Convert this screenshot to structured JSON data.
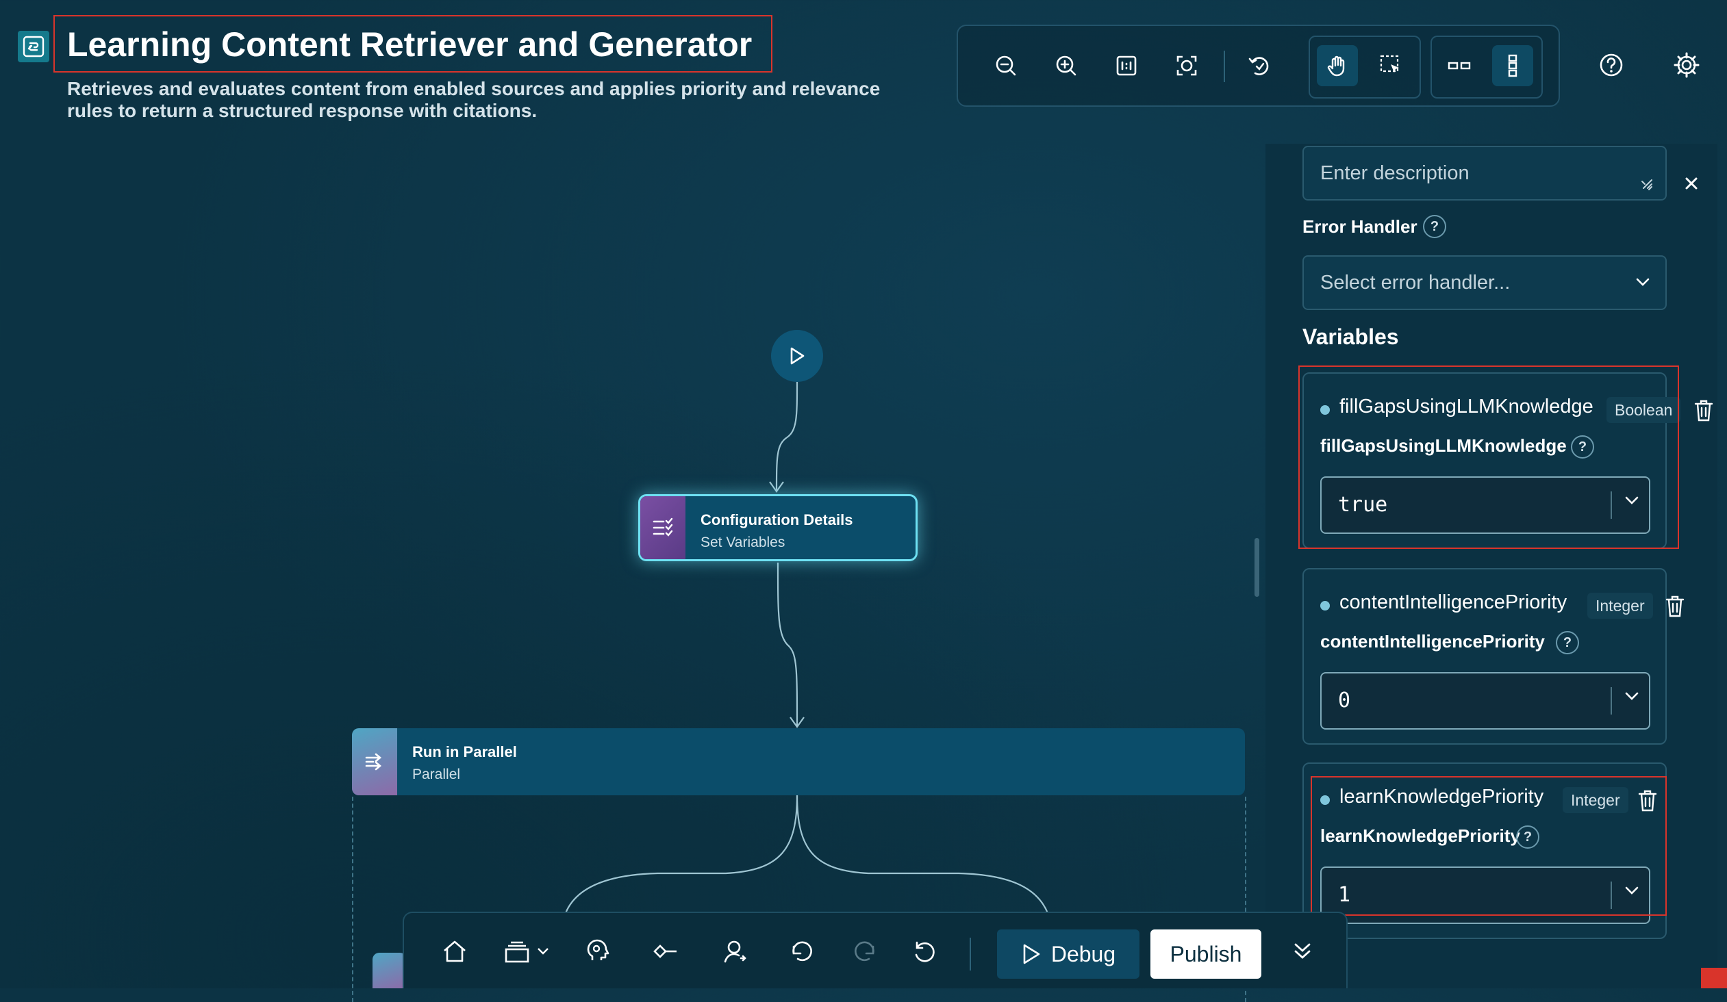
{
  "header": {
    "title": "Learning Content Retriever and Generator",
    "subtitle": "Retrieves and evaluates content from enabled sources and applies priority and relevance rules to return a structured response with citations."
  },
  "toolbar": {
    "icons": [
      "zoom-out-icon",
      "zoom-in-icon",
      "actual-size-icon",
      "fit-to-screen-icon",
      "reset-view-icon",
      "pan-hand-icon",
      "select-area-icon",
      "horizontal-layout-icon",
      "vertical-layout-icon"
    ],
    "help_icon": "help-icon",
    "settings_icon": "gear-icon"
  },
  "canvas": {
    "config_node": {
      "title": "Configuration Details",
      "subtitle": "Set Variables"
    },
    "parallel_node": {
      "title": "Run in Parallel",
      "subtitle": "Parallel"
    }
  },
  "panel": {
    "description_placeholder": "Enter description",
    "error_handler_label": "Error Handler",
    "error_handler_placeholder": "Select error handler...",
    "variables_title": "Variables",
    "variables": [
      {
        "name": "fillGapsUsingLLMKnowledge",
        "type": "Boolean",
        "label": "fillGapsUsingLLMKnowledge",
        "value": "true"
      },
      {
        "name": "contentIntelligencePriority",
        "type": "Integer",
        "label": "contentIntelligencePriority",
        "value": "0"
      },
      {
        "name": "learnKnowledgePriority",
        "type": "Integer",
        "label": "learnKnowledgePriority",
        "value": "1"
      }
    ]
  },
  "bottom_bar": {
    "debug_label": "Debug",
    "publish_label": "Publish"
  },
  "colors": {
    "background": "#0c3344",
    "node": "#0b4d6a",
    "highlight": "#6ee0f2",
    "annotation_red": "#d9342b"
  }
}
